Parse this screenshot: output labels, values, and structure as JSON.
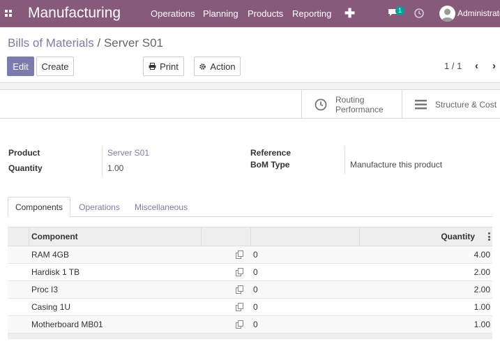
{
  "navbar": {
    "app_title": "Manufacturing",
    "menu": [
      "Operations",
      "Planning",
      "Products",
      "Reporting"
    ],
    "add_symbol": "✚",
    "chat_count": "1",
    "user": "Administrator",
    "accent": "#875a7b"
  },
  "breadcrumb": {
    "parent": "Bills of Materials",
    "separator": " / ",
    "current": "Server S01"
  },
  "buttons": {
    "edit": "Edit",
    "create": "Create",
    "print": "Print",
    "action": "Action"
  },
  "pager": {
    "value": "1 / 1"
  },
  "smart_buttons": {
    "routing_line1": "Routing",
    "routing_line2": "Performance",
    "structure_cost": "Structure & Cost"
  },
  "fields": {
    "product_label": "Product",
    "product_value": "Server S01",
    "quantity_label": "Quantity",
    "quantity_value": "1.00",
    "reference_label": "Reference",
    "reference_value": "",
    "bom_type_label": "BoM Type",
    "bom_type_value": "Manufacture this product"
  },
  "tabs": [
    "Components",
    "Operations",
    "Miscellaneous"
  ],
  "table": {
    "headers": {
      "component": "Component",
      "quantity": "Quantity"
    },
    "rows": [
      {
        "component": "RAM 4GB",
        "count": "0",
        "quantity": "4.00"
      },
      {
        "component": "Hardisk 1 TB",
        "count": "0",
        "quantity": "2.00"
      },
      {
        "component": "Proc I3",
        "count": "0",
        "quantity": "2.00"
      },
      {
        "component": "Casing 1U",
        "count": "0",
        "quantity": "1.00"
      },
      {
        "component": "Motherboard MB01",
        "count": "0",
        "quantity": "1.00"
      }
    ]
  },
  "icons": {
    "apps": "apps-grid-icon",
    "chat": "chat-icon",
    "activity": "clock-icon",
    "print": "print-icon",
    "action": "gear-icon",
    "routing": "clock-icon",
    "structure": "bars-icon",
    "row_copy": "copy-icon",
    "options": "kebab-icon"
  },
  "colors": {
    "link": "#7c7bad",
    "primary": "#7c7bad",
    "badge": "#00a09d"
  }
}
